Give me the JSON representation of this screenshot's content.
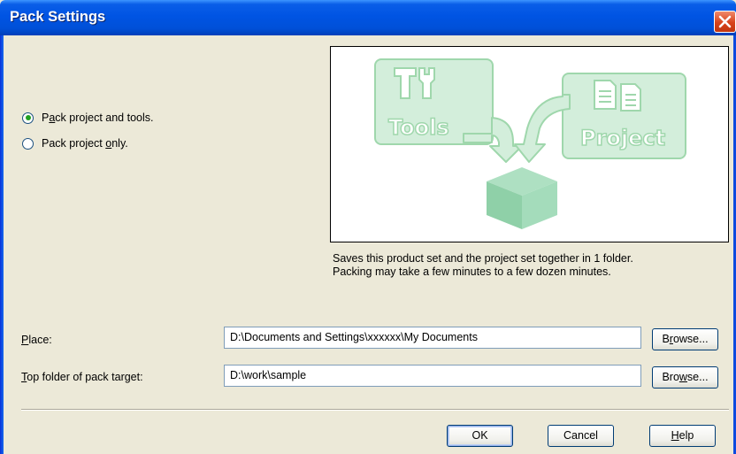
{
  "window": {
    "title": "Pack Settings"
  },
  "options": [
    {
      "label_pre": "P",
      "label_key": "a",
      "label_post": "ck project and tools.",
      "selected": true
    },
    {
      "label_pre": "Pack project ",
      "label_key": "o",
      "label_post": "nly.",
      "selected": false
    }
  ],
  "illustration": {
    "tools_label": "Tools",
    "project_label": "Project"
  },
  "description": {
    "line1": "Saves this product set and the project set together in 1 folder.",
    "line2": "Packing may take a few minutes to a few dozen minutes."
  },
  "place": {
    "label_key": "P",
    "label_post": "lace:",
    "value": "D:\\Documents and Settings\\xxxxxx\\My Documents",
    "browse_pre": "B",
    "browse_key": "r",
    "browse_post": "owse..."
  },
  "top_folder": {
    "label_key": "T",
    "label_post": "op folder of pack target:",
    "value": "D:\\work\\sample",
    "browse_pre": "Bro",
    "browse_key": "w",
    "browse_post": "se..."
  },
  "buttons": {
    "ok": "OK",
    "cancel": "Cancel",
    "help_key": "H",
    "help_post": "elp"
  },
  "colors": {
    "titlebar": "#0054e3",
    "dialog_bg": "#ece9d8",
    "illustration_green": "#8fd19e"
  }
}
